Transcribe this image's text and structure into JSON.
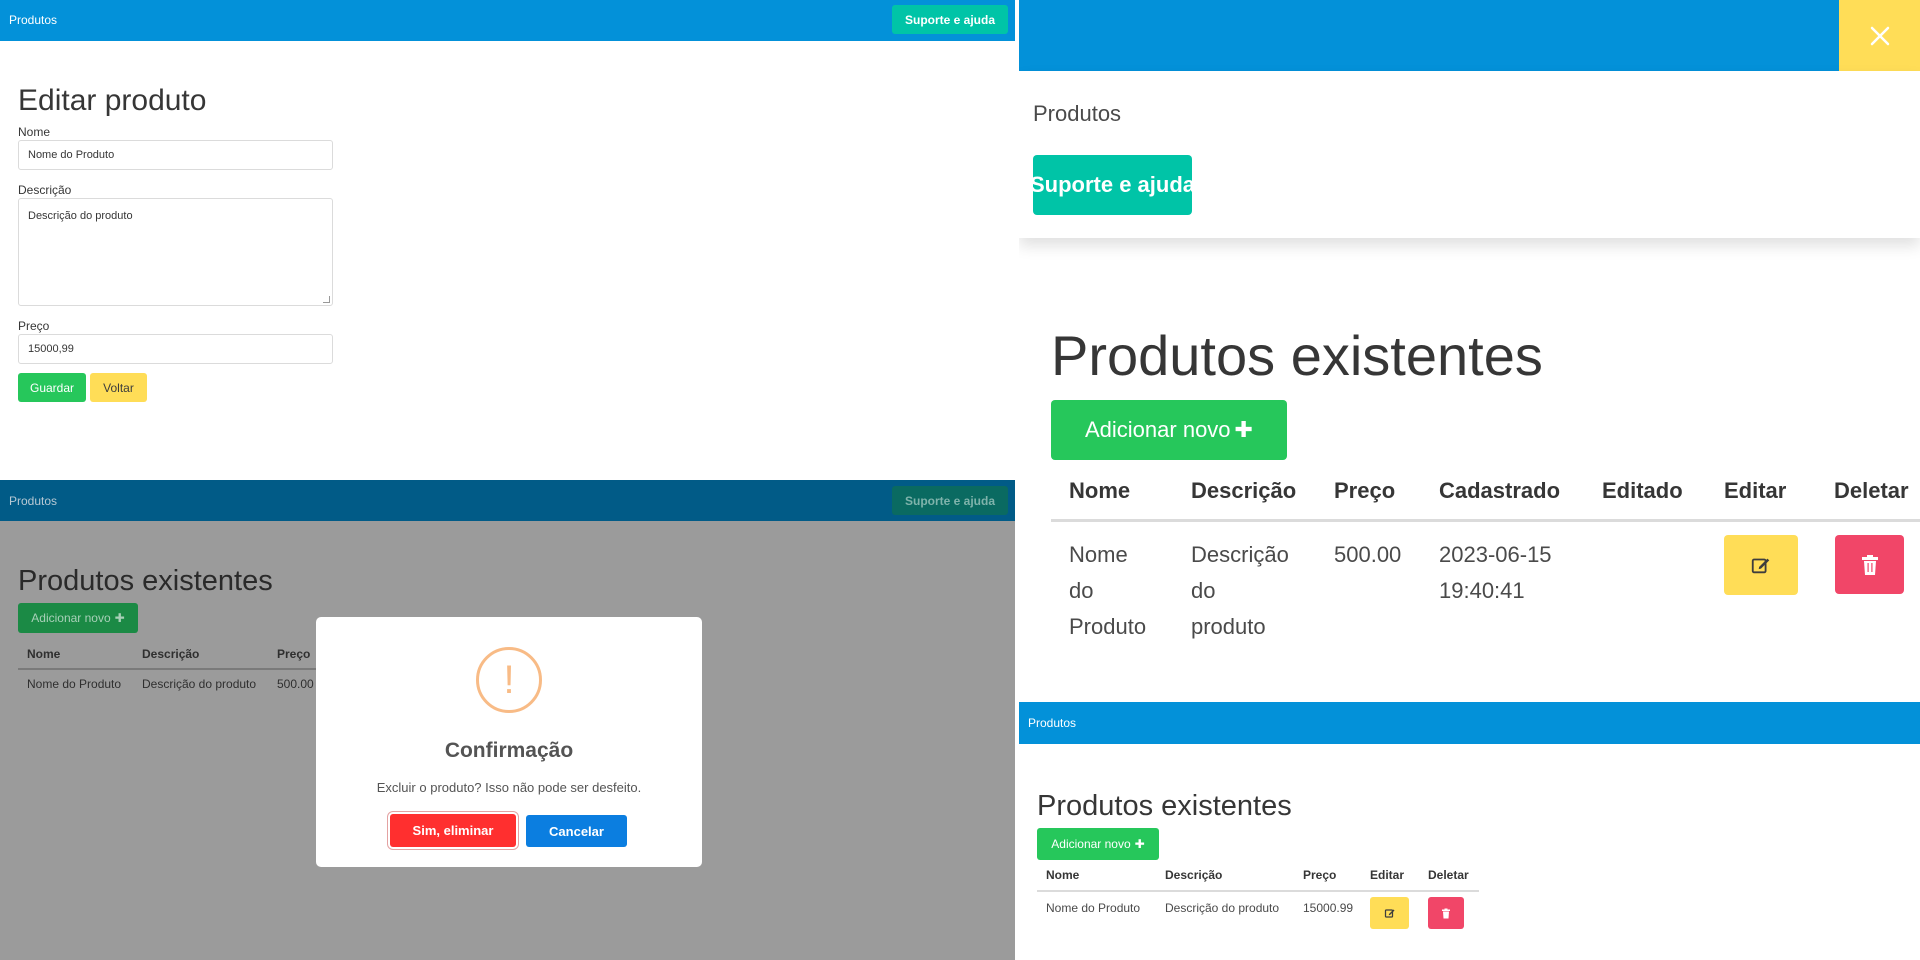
{
  "colors": {
    "navbar": "#0391d9",
    "support_button": "#00c4a7",
    "success": "#26c75b",
    "warning": "#ffdd57",
    "danger": "#f14668",
    "modal_confirm": "#ff2f2f",
    "modal_cancel": "#0b7ee0",
    "overlay_bg": "#9b9b9b"
  },
  "edit_panel": {
    "navbar": {
      "brand": "Produtos",
      "support_label": "Suporte e ajuda"
    },
    "title": "Editar produto",
    "fields": {
      "name_label": "Nome",
      "name_value": "Nome do Produto",
      "description_label": "Descrição",
      "description_value": "Descrição do produto",
      "price_label": "Preço",
      "price_value": "15000,99"
    },
    "buttons": {
      "save": "Guardar",
      "back": "Voltar"
    }
  },
  "confirm_panel": {
    "navbar": {
      "brand": "Produtos",
      "support_label": "Suporte e ajuda"
    },
    "background": {
      "title": "Produtos existentes",
      "add_label": "Adicionar novo",
      "headers": [
        "Nome",
        "Descrição",
        "Preço"
      ],
      "row": [
        "Nome do Produto",
        "Descrição do produto",
        "500.00"
      ]
    },
    "modal": {
      "icon_glyph": "!",
      "title": "Confirmação",
      "text": "Excluir o produto? Isso não pode ser desfeito.",
      "confirm_label": "Sim, eliminar",
      "cancel_label": "Cancelar"
    }
  },
  "mobile_panel": {
    "close_icon": "close-icon",
    "menu": {
      "item": "Produtos",
      "support_label": "Suporte e ajuda"
    },
    "title": "Produtos existentes",
    "add_label": "Adicionar novo",
    "headers": [
      "Nome",
      "Descrição",
      "Preço",
      "Cadastrado",
      "Editado",
      "Editar",
      "Deletar"
    ],
    "row": {
      "name": [
        "Nome",
        "do",
        "Produto"
      ],
      "description": [
        "Descrição",
        "do",
        "produto"
      ],
      "price": "500.00",
      "created": [
        "2023-06-15",
        "19:40:41"
      ],
      "edited": ""
    }
  },
  "list_panel": {
    "navbar": {
      "brand": "Produtos"
    },
    "title": "Produtos existentes",
    "add_label": "Adicionar novo",
    "headers": [
      "Nome",
      "Descrição",
      "Preço",
      "Editar",
      "Deletar"
    ],
    "row": [
      "Nome do Produto",
      "Descrição do produto",
      "15000.99"
    ]
  }
}
